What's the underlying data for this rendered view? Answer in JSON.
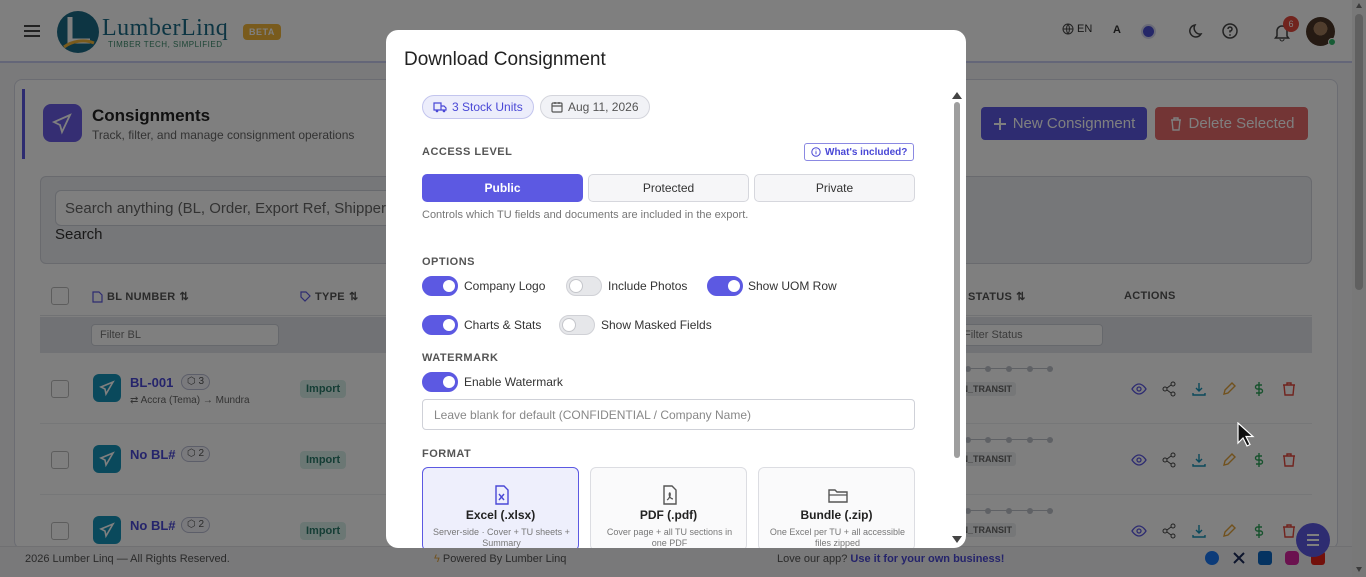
{
  "app": {
    "brand_name": "LumberLinq",
    "brand_tagline": "TIMBER TECH, SIMPLIFIED",
    "beta_label": "BETA",
    "lang": "EN",
    "font_toggle": "A",
    "notification_count": "6",
    "accent_color": "#5c59e2"
  },
  "page": {
    "title": "Consignments",
    "subtitle": "Track, filter, and manage consignment operations",
    "new_button": "New Consignment",
    "delete_button": "Delete Selected",
    "search_placeholder": "Search anything (BL, Order, Export Ref, Shipper...",
    "search_label": "Search"
  },
  "table": {
    "columns": [
      "BL NUMBER",
      "TYPE",
      "STATUS",
      "ACTIONS"
    ],
    "filter_bl": "Filter BL",
    "filter_status": "Filter Status",
    "rows": [
      {
        "bl": "BL-001",
        "count": "3",
        "route_from": "Accra (Tema)",
        "route_to": "Mundra",
        "type": "Import",
        "status": "IN_TRANSIT"
      },
      {
        "bl": "No BL#",
        "count": "2",
        "type": "Import",
        "status": "IN_TRANSIT"
      },
      {
        "bl": "No BL#",
        "count": "2",
        "type": "Import",
        "status": "IN_TRANSIT"
      }
    ]
  },
  "footer": {
    "copyright": "2026 Lumber Linq — All Rights Reserved.",
    "powered": "Powered By Lumber Linq",
    "love_text": "Love our app?",
    "love_link": "Use it for your own business!"
  },
  "modal": {
    "title": "Download Consignment",
    "chip_units": "3 Stock Units",
    "chip_date": "Aug 11, 2026",
    "access_level_label": "ACCESS LEVEL",
    "whats_included": "What's included?",
    "access_options": [
      "Public",
      "Protected",
      "Private"
    ],
    "access_selected": "Public",
    "access_help": "Controls which TU fields and documents are included in the export.",
    "options_label": "OPTIONS",
    "options": [
      {
        "label": "Company Logo",
        "on": true
      },
      {
        "label": "Include Photos",
        "on": false
      },
      {
        "label": "Show UOM Row",
        "on": true
      },
      {
        "label": "Charts & Stats",
        "on": true
      },
      {
        "label": "Show Masked Fields",
        "on": false
      }
    ],
    "watermark_label": "WATERMARK",
    "watermark_toggle": "Enable Watermark",
    "watermark_on": true,
    "watermark_placeholder": "Leave blank for default (CONFIDENTIAL / Company Name)",
    "format_label": "FORMAT",
    "formats": [
      {
        "name": "Excel (.xlsx)",
        "desc": "Server-side · Cover + TU sheets + Summary",
        "icon": "excel-file-icon",
        "selected": true
      },
      {
        "name": "PDF (.pdf)",
        "desc": "Cover page + all TU sections in one PDF",
        "icon": "pdf-file-icon",
        "selected": false
      },
      {
        "name": "Bundle (.zip)",
        "desc": "One Excel per TU + all accessible files zipped",
        "icon": "folder-icon",
        "selected": false
      }
    ]
  }
}
